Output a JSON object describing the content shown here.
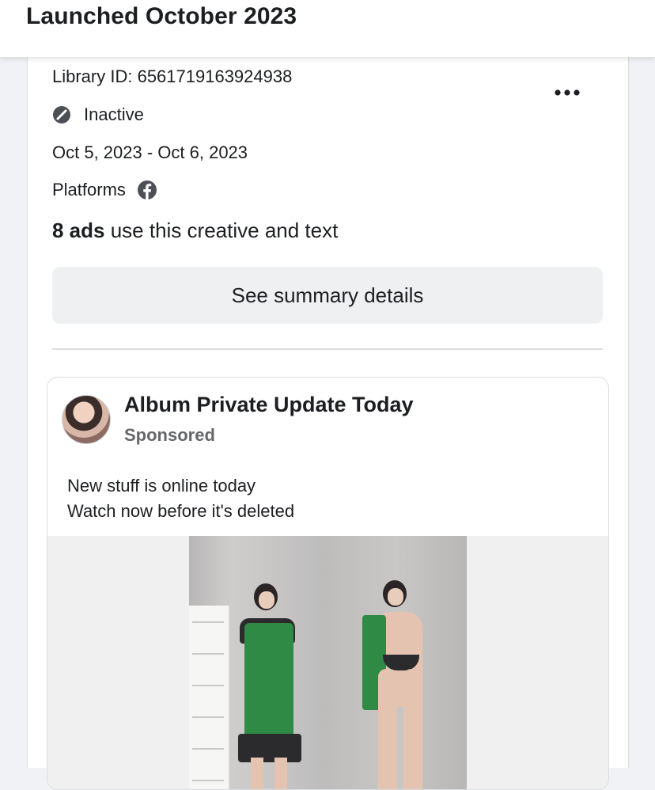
{
  "header": {
    "title": "Launched October 2023"
  },
  "ad_card": {
    "library_id": "Library ID: 6561719163924938",
    "status": "Inactive",
    "date_range": "Oct 5, 2023 - Oct 6, 2023",
    "platforms_label": "Platforms",
    "platform_icons": [
      "facebook-icon"
    ],
    "ads_count": "8 ads",
    "ads_count_suffix": " use this creative and text",
    "summary_button": "See summary details",
    "more_icon": "more-options-icon"
  },
  "ad_preview": {
    "page_name": "Album Private Update Today",
    "sponsored_label": "Sponsored",
    "body_lines": [
      "New stuff is online today",
      "Watch now before it's deleted"
    ]
  },
  "colors": {
    "background": "#f0f2f5",
    "card": "#ffffff",
    "button_bg": "#eff0f2",
    "secondary_text": "#65676b",
    "apron_green": "#2f8a45"
  }
}
